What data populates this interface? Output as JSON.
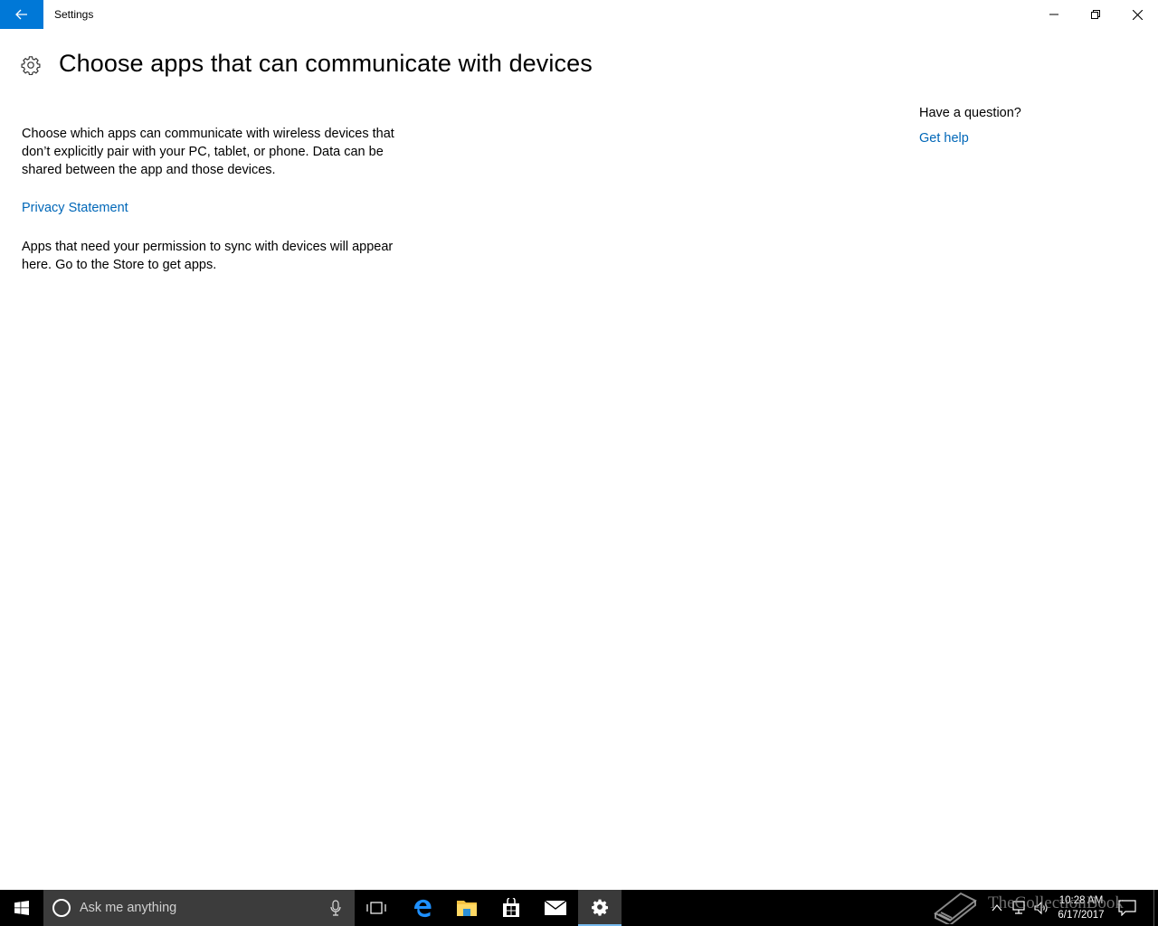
{
  "window": {
    "title": "Settings",
    "back_label": "Back",
    "accent_color": "#0078d7"
  },
  "page": {
    "title": "Choose apps that can communicate with devices",
    "icon": "gear-icon",
    "description": "Choose which apps can communicate with wireless devices that don’t explicitly pair with your PC, tablet, or phone. Data can be shared between the app and those devices.",
    "privacy_link": "Privacy Statement",
    "empty_note": "Apps that need your permission to sync with devices will appear here. Go to the Store to get apps."
  },
  "side_panel": {
    "question": "Have a question?",
    "help_link": "Get help"
  },
  "taskbar": {
    "search_placeholder": "Ask me anything",
    "pinned": [
      "task-view-icon",
      "edge-icon",
      "file-explorer-icon",
      "store-icon",
      "mail-icon",
      "settings-icon"
    ],
    "active_app": "settings-icon",
    "clock_time": "10:28 AM",
    "clock_date": "6/17/2017"
  },
  "watermark": {
    "text": "TheCollectionBook"
  }
}
